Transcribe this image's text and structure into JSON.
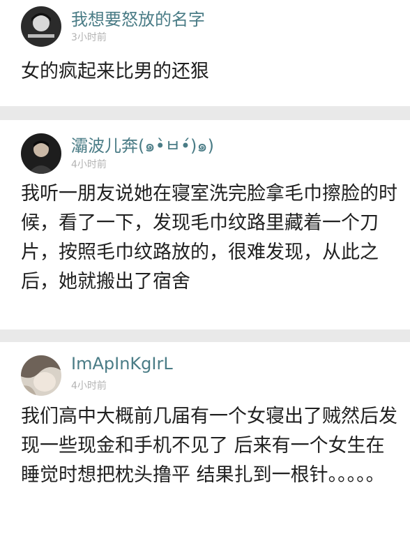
{
  "comments": [
    {
      "username": "我想要怒放的名字",
      "time": "3小时前",
      "text": "女的疯起来比男的还狠"
    },
    {
      "username": "灞波儿奔(๑•̀ㅂ•́)๑)",
      "time": "4小时前",
      "text": "我听一朋友说她在寝室洗完脸拿毛巾擦脸的时候，看了一下，发现毛巾纹路里藏着一个刀片，按照毛巾纹路放的，很难发现，从此之后，她就搬出了宿舍"
    },
    {
      "username": "ImApInKgIrL",
      "time": "4小时前",
      "text": "我们高中大概前几届有一个女寝出了贼然后发现一些现金和手机不见了  后来有一个女生在睡觉时想把枕头撸平  结果扎到一根针。。。。。"
    }
  ],
  "colors": {
    "username": "#4a7c86",
    "time": "#b3b3b3",
    "text": "#1f1f1f",
    "separator": "#e9e9e9"
  }
}
